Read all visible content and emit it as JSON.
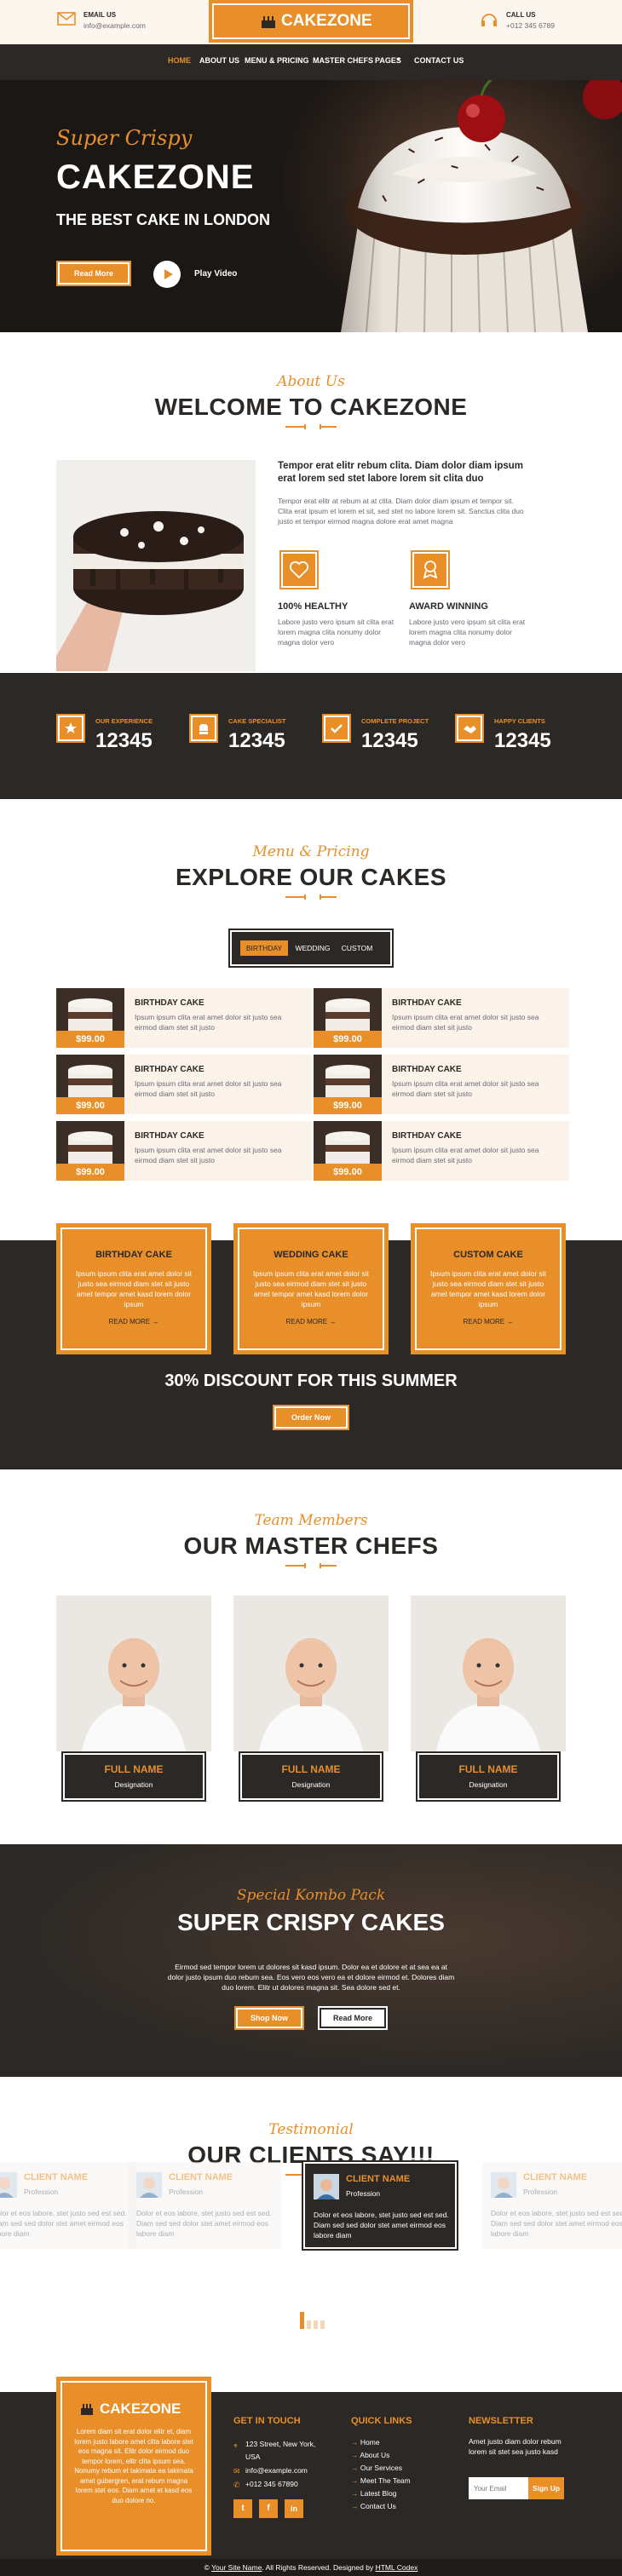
{
  "topbar": {
    "email_label": "EMAIL US",
    "email_value": "info@example.com",
    "brand": "CAKEZONE",
    "call_label": "CALL US",
    "call_value": "+012 345 6789"
  },
  "nav": [
    "HOME",
    "ABOUT US",
    "MENU & PRICING",
    "MASTER CHEFS",
    "PAGES",
    "CONTACT US"
  ],
  "hero": {
    "tag": "Super Crispy",
    "title": "CAKEZONE",
    "subtitle": "THE BEST CAKE IN LONDON",
    "btn": "Read More",
    "play": "Play Video"
  },
  "about": {
    "sub": "About Us",
    "title": "WELCOME TO CAKEZONE",
    "lead": "Tempor erat elitr rebum clita. Diam dolor diam ipsum erat lorem sed stet labore lorem sit clita duo",
    "body": "Tempor erat elitr at rebum at at clita. Diam dolor diam ipsum et tempor sit. Clita erat ipsum et lorem et sit, sed stet no labore lorem sit. Sanctus clita duo justo et tempor eirmod magna dolore erat amet magna",
    "f1_title": "100% HEALTHY",
    "f1_text": "Labore justo vero ipsum sit clita erat lorem magna clita nonumy dolor magna dolor vero",
    "f2_title": "AWARD WINNING",
    "f2_text": "Labore justo vero ipsum sit clita erat lorem magna clita nonumy dolor magna dolor vero"
  },
  "facts": [
    {
      "label": "OUR EXPERIENCE",
      "value": "12345"
    },
    {
      "label": "CAKE SPECIALIST",
      "value": "12345"
    },
    {
      "label": "COMPLETE PROJECT",
      "value": "12345"
    },
    {
      "label": "HAPPY CLIENTS",
      "value": "12345"
    }
  ],
  "menu": {
    "sub": "Menu & Pricing",
    "title": "EXPLORE OUR CAKES",
    "tabs": [
      "BIRTHDAY",
      "WEDDING",
      "CUSTOM"
    ],
    "item_title": "BIRTHDAY CAKE",
    "item_desc": "Ipsum ipsum clita erat amet dolor sit justo sea eirmod diam stet sit justo",
    "item_price": "$99.00"
  },
  "services": [
    {
      "title": "BIRTHDAY CAKE",
      "desc": "Ipsum ipsum clita erat amet dolor sit justo sea eirmod diam stet sit justo amet tempor amet kasd lorem dolor ipsum",
      "link": "READ MORE →"
    },
    {
      "title": "WEDDING CAKE",
      "desc": "Ipsum ipsum clita erat amet dolor sit justo sea eirmod diam stet sit justo amet tempor amet kasd lorem dolor ipsum",
      "link": "READ MORE →"
    },
    {
      "title": "CUSTOM CAKE",
      "desc": "Ipsum ipsum clita erat amet dolor sit justo sea eirmod diam stet sit justo amet tempor amet kasd lorem dolor ipsum",
      "link": "READ MORE →"
    }
  ],
  "discount": {
    "title": "30% DISCOUNT FOR THIS SUMMER",
    "btn": "Order Now"
  },
  "team": {
    "sub": "Team Members",
    "title": "OUR MASTER CHEFS",
    "name": "FULL NAME",
    "role": "Designation"
  },
  "offer": {
    "sub": "Special Kombo Pack",
    "title": "SUPER CRISPY CAKES",
    "text": "Eirmod sed tempor lorem ut dolores sit kasd ipsum. Dolor ea et dolore et at sea ea at dolor justo ipsum duo rebum sea. Eos vero eos vero ea et dolore eirmod et. Dolores diam duo lorem. Elitr ut dolores magna sit. Sea dolore sed et.",
    "btn1": "Shop Now",
    "btn2": "Read More"
  },
  "testi": {
    "sub": "Testimonial",
    "title": "OUR CLIENTS SAY!!!",
    "name": "CLIENT NAME",
    "role": "Profession",
    "text": "Dolor et eos labore, stet justo sed est sed. Diam sed sed dolor stet amet eirmod eos labore diam"
  },
  "footer": {
    "brand": "CAKEZONE",
    "about": "Lorem diam sit erat dolor elitr et, diam lorem justo labore amet clita labore stet eos magna sit. Elitr dolor eirmod duo tempor lorem, elitr clita ipsum sea. Nonumy rebum et takimata ea takimata amet gubergren, erat rebum magna lorem stet eos. Diam amet et kasd eos duo dolore no.",
    "touch_title": "GET IN TOUCH",
    "address": "123 Street, New York, USA",
    "email": "info@example.com",
    "phone": "+012 345 67890",
    "links_title": "QUICK LINKS",
    "links": [
      "Home",
      "About Us",
      "Our Services",
      "Meet The Team",
      "Latest Blog",
      "Contact Us"
    ],
    "news_title": "NEWSLETTER",
    "news_text": "Amet justo diam dolor rebum lorem sit stet sea justo kasd",
    "news_placeholder": "Your Email",
    "news_btn": "Sign Up",
    "copy_a": "©",
    "copy_site": "Your Site Name",
    "copy_b": ". All Rights Reserved. Designed by",
    "copy_designer": "HTML Codex"
  },
  "colors": {
    "accent": "#E88F2A",
    "dark": "#2B2825",
    "cream": "#FBF3EA"
  }
}
